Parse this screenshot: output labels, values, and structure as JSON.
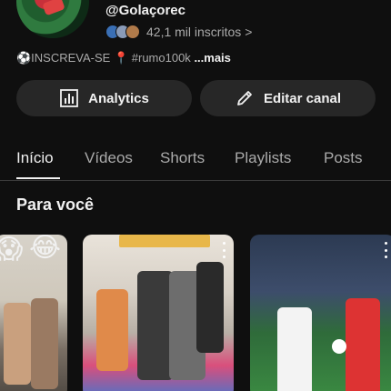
{
  "channel": {
    "handle": "@Golaçorec",
    "subscribers": "42,1 mil inscritos",
    "subscribers_chevron": ">",
    "description": "⚽INSCREVA-SE 📍 #rumo100k",
    "description_more": "...mais"
  },
  "actions": {
    "analytics_label": "Analytics",
    "edit_label": "Editar canal"
  },
  "tabs": [
    {
      "label": "Início",
      "active": true
    },
    {
      "label": "Vídeos",
      "active": false
    },
    {
      "label": "Shorts",
      "active": false
    },
    {
      "label": "Playlists",
      "active": false
    },
    {
      "label": "Posts",
      "active": false
    }
  ],
  "section": {
    "title": "Para você"
  },
  "thumbnails": {
    "first_emojis": [
      "😱",
      "😂"
    ]
  }
}
